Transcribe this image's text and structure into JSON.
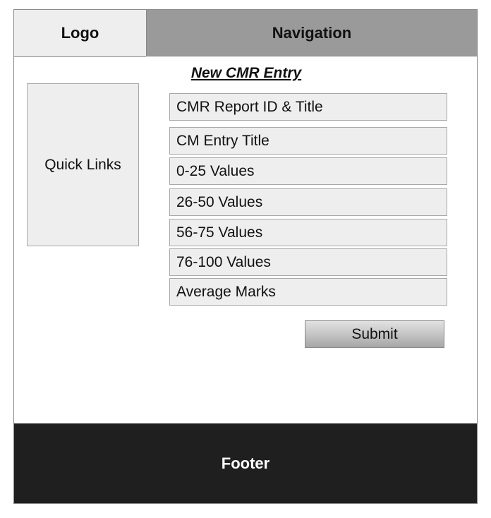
{
  "header": {
    "logo_label": "Logo",
    "navigation_label": "Navigation"
  },
  "page_title": "New CMR Entry",
  "sidebar": {
    "quick_links_label": "Quick Links"
  },
  "form": {
    "fields": [
      {
        "label": "CMR Report ID & Title"
      },
      {
        "label": "CM Entry Title"
      },
      {
        "label": "0-25 Values"
      },
      {
        "label": "26-50 Values"
      },
      {
        "label": "56-75 Values"
      },
      {
        "label": "76-100 Values"
      },
      {
        "label": "Average Marks"
      }
    ],
    "submit_label": "Submit"
  },
  "footer": {
    "label": "Footer"
  },
  "colors": {
    "header_logo_bg": "#eeeeee",
    "header_nav_bg": "#9a9a9a",
    "field_bg": "#eeeeee",
    "footer_bg": "#1f1f1f",
    "footer_text": "#ffffff"
  }
}
